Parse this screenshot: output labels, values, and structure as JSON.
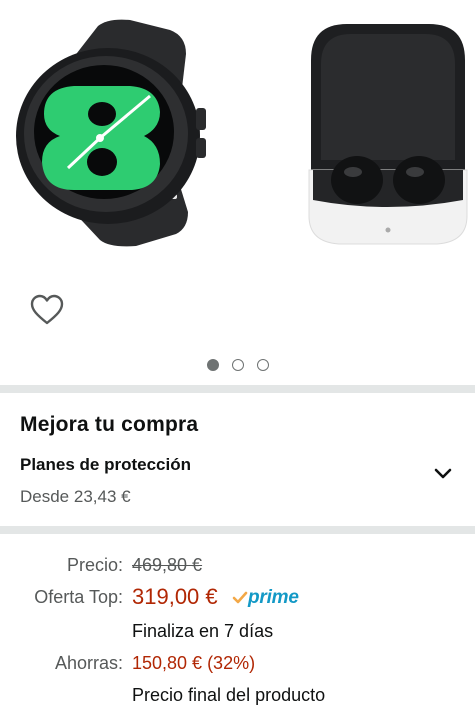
{
  "gallery": {
    "product_images": [
      "smartwatch",
      "wireless-earbuds"
    ],
    "image_count": 3,
    "active_index": 0
  },
  "upgrade": {
    "title": "Mejora tu compra",
    "plans_title": "Planes de protección",
    "plans_price": "Desde 23,43 €"
  },
  "pricing": {
    "list_price_label": "Precio:",
    "list_price": "469,80 €",
    "deal_label": "Oferta Top:",
    "deal_price": "319,00 €",
    "prime_label": "prime",
    "deal_ends": "Finaliza en 7 días",
    "savings_label": "Ahorras:",
    "savings": "150,80 € (32%)",
    "final_note": "Precio final del producto"
  },
  "colors": {
    "deal_red": "#b12704",
    "prime_blue": "#1399c6",
    "prime_check": "#f3a847",
    "divider": "#e3e6e6"
  }
}
